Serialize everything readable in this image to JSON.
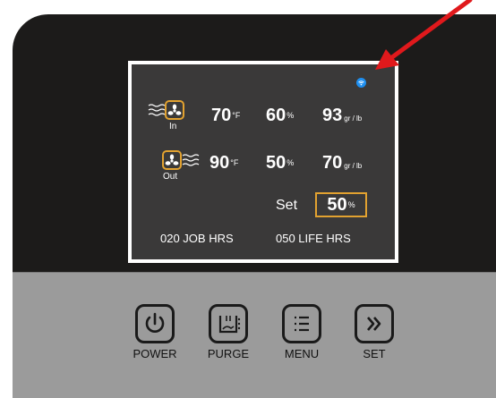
{
  "display": {
    "in_label": "In",
    "out_label": "Out",
    "in_row": {
      "temp_value": "70",
      "temp_unit": "°F",
      "humidity_value": "60",
      "humidity_unit": "%",
      "grains_value": "93",
      "grains_unit": "gr / lb"
    },
    "out_row": {
      "temp_value": "90",
      "temp_unit": "°F",
      "humidity_value": "50",
      "humidity_unit": "%",
      "grains_value": "70",
      "grains_unit": "gr / lb"
    },
    "set": {
      "label": "Set",
      "value": "50",
      "unit": "%"
    },
    "job_hrs": "020  JOB HRS",
    "life_hrs": "050  LIFE HRS"
  },
  "buttons": [
    {
      "label": "POWER",
      "icon": "power-icon"
    },
    {
      "label": "PURGE",
      "icon": "purge-icon"
    },
    {
      "label": "MENU",
      "icon": "menu-icon"
    },
    {
      "label": "SET",
      "icon": "next-icon"
    }
  ],
  "colors": {
    "body": "#1c1b1a",
    "screen": "#3a3939",
    "accent": "#e2a230",
    "wifi": "#1e8ff0",
    "panel": "#9b9b9b",
    "arrow": "#e0191c"
  }
}
